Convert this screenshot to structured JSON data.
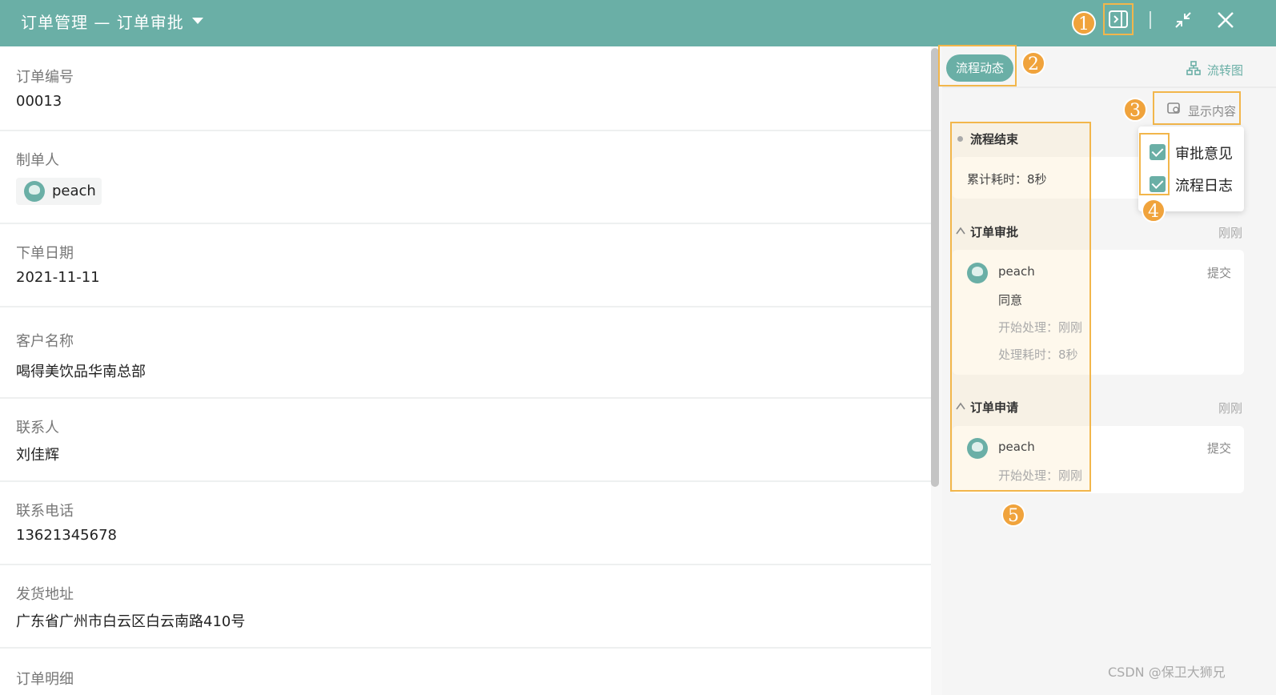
{
  "header": {
    "title": "订单管理 — 订单审批",
    "color": "#6aafa6"
  },
  "annotations": [
    "1",
    "2",
    "3",
    "4",
    "5"
  ],
  "form": {
    "fields": [
      {
        "label": "订单编号",
        "value": "00013"
      },
      {
        "label": "制单人",
        "value": "peach"
      },
      {
        "label": "下单日期",
        "value": "2021-11-11"
      },
      {
        "label": "客户名称",
        "value": "喝得美饮品华南总部"
      },
      {
        "label": "联系人",
        "value": "刘佳辉"
      },
      {
        "label": "联系电话",
        "value": "13621345678"
      },
      {
        "label": "发货地址",
        "value": "广东省广州市白云区白云南路410号"
      },
      {
        "label": "订单明细",
        "value": ""
      }
    ]
  },
  "panel": {
    "tab_label": "流程动态",
    "flowchart_link": "流转图",
    "display_content": "显示内容",
    "options": [
      {
        "label": "审批意见",
        "checked": true
      },
      {
        "label": "流程日志",
        "checked": true
      }
    ],
    "sections": [
      {
        "title": "流程结束",
        "time": "",
        "summary": "累计耗时：8秒"
      },
      {
        "title": "订单审批",
        "time": "刚刚",
        "user": "peach",
        "action": "提交",
        "opinion": "同意",
        "start": "开始处理：刚刚",
        "duration": "处理耗时：8秒"
      },
      {
        "title": "订单申请",
        "time": "刚刚",
        "user": "peach",
        "action": "提交",
        "start": "开始处理：刚刚"
      }
    ]
  },
  "watermark": "CSDN @保卫大狮兄"
}
